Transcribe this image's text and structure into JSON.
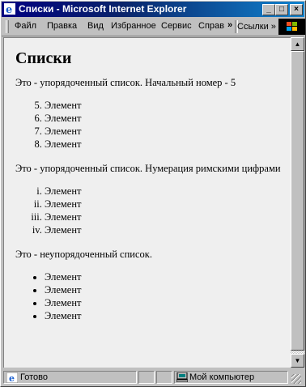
{
  "window": {
    "title": "Списки - Microsoft Internet Explorer"
  },
  "title_buttons": {
    "minimize": "_",
    "maximize": "□",
    "close": "×"
  },
  "menu": {
    "items": [
      "Файл",
      "Правка",
      "Вид",
      "Избранное",
      "Сервис",
      "Справ"
    ],
    "overflow": "»",
    "links": "Ссылки »"
  },
  "page": {
    "heading": "Списки",
    "p1": "Это - упорядоченный список. Начальный номер - 5",
    "list1_start": 5,
    "list1": [
      "Элемент",
      "Элемент",
      "Элемент",
      "Элемент"
    ],
    "p2": "Это - упорядоченный список. Нумерация римскими цифрами",
    "list2": [
      "Элемент",
      "Элемент",
      "Элемент",
      "Элемент"
    ],
    "p3": "Это - неупорядоченный список.",
    "list3": [
      "Элемент",
      "Элемент",
      "Элемент",
      "Элемент"
    ]
  },
  "scrollbar": {
    "up": "▲",
    "down": "▼"
  },
  "status": {
    "text": "Готово",
    "zone": "Мой компьютер"
  },
  "colors": {
    "titlebar_start": "#000080",
    "titlebar_end": "#1084d0",
    "page_bg": "#efefef"
  }
}
